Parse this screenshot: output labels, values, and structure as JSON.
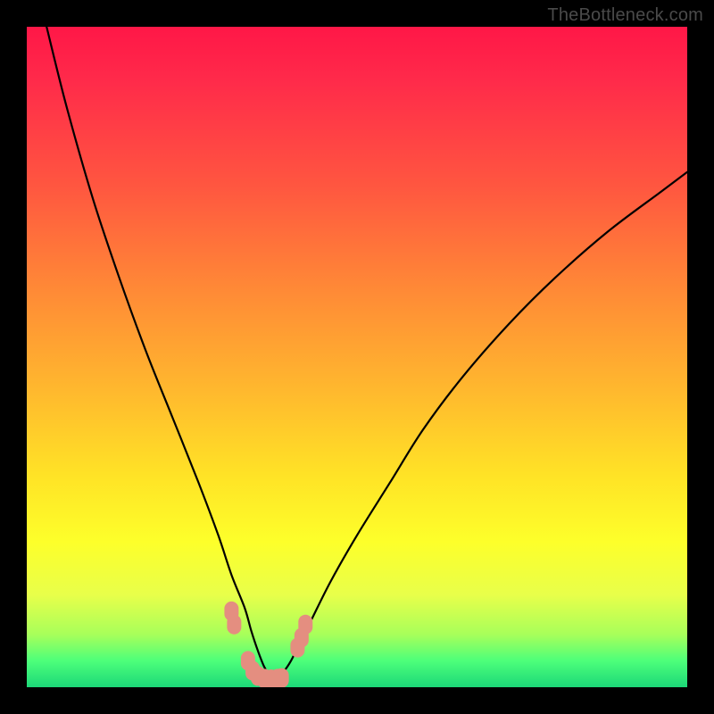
{
  "watermark": "TheBottleneck.com",
  "chart_data": {
    "type": "line",
    "title": "",
    "xlabel": "",
    "ylabel": "",
    "xlim": [
      0,
      100
    ],
    "ylim": [
      0,
      100
    ],
    "curve_black": {
      "name": "bottleneck-curve",
      "description": "V-shaped black curve, minimum near x≈37",
      "x": [
        3,
        6,
        10,
        14,
        18,
        22,
        26,
        29,
        31,
        33,
        34,
        35,
        36,
        37,
        38,
        39,
        40,
        41,
        43,
        46,
        50,
        55,
        60,
        66,
        73,
        80,
        88,
        96,
        100
      ],
      "y": [
        100,
        88,
        74,
        62,
        51,
        41,
        31,
        23,
        17,
        12,
        8.5,
        5.5,
        3,
        1.5,
        1.5,
        2.5,
        4,
        6,
        10,
        16,
        23,
        31,
        39,
        47,
        55,
        62,
        69,
        75,
        78
      ]
    },
    "points_pink": {
      "name": "near-optimal-markers",
      "description": "Pink rounded markers near the curve minimum",
      "x": [
        31.0,
        31.4,
        33.5,
        34.2,
        35.0,
        36.0,
        37.0,
        38.0,
        38.6,
        41.0,
        41.6,
        42.2
      ],
      "y": [
        11.5,
        9.5,
        4.0,
        2.5,
        1.7,
        1.3,
        1.2,
        1.3,
        1.4,
        6.0,
        7.5,
        9.5
      ]
    },
    "colors": {
      "curve": "#000000",
      "markers": "#e48e80",
      "gradient_top": "#ff1747",
      "gradient_bottom": "#1cd878",
      "frame": "#000000",
      "watermark": "#4a4a4a"
    }
  }
}
